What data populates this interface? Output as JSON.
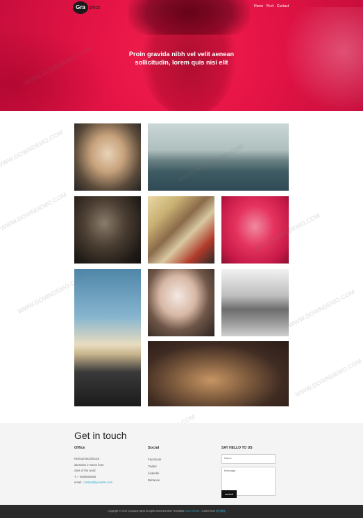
{
  "header": {
    "logo_mark": "Gra",
    "logo_rest": "phics",
    "nav": [
      "Home",
      "Work",
      "Contact"
    ],
    "hero_title_line1": "Proin gravida nibh vel velit aenean",
    "hero_title_line2": "sollicitudin, lorem quis nisi elit"
  },
  "gallery": {
    "tiles": [
      {
        "name": "woman-flower-crown-photo"
      },
      {
        "name": "misty-landscape-photo"
      },
      {
        "name": "man-in-dark-photo"
      },
      {
        "name": "colorful-cards-photo"
      },
      {
        "name": "red-portrait-photo"
      },
      {
        "name": "vintage-car-photo"
      },
      {
        "name": "woman-with-books-photo"
      },
      {
        "name": "street-with-dog-photo"
      },
      {
        "name": "cat-photo"
      }
    ]
  },
  "contact": {
    "title": "Get in touch",
    "office": {
      "title": "Office",
      "lines": [
        "Richard McClintock",
        "alteration in some form",
        "cites of the word",
        "T: + 0000000000"
      ],
      "email_label": "email :",
      "email_value": "contact@yoursite.com"
    },
    "social": {
      "title": "Social",
      "links": [
        "Facebook",
        "Twitter",
        "Linkedin",
        "Behance"
      ]
    },
    "form": {
      "title": "SAY HELLO TO US",
      "name_placeholder": "Name",
      "message_placeholder": "Message",
      "submit_label": "submit"
    }
  },
  "footer": {
    "text": "Copyright © 2014 Company name All rights reserved More Templates ",
    "link1": "more themes",
    "mid": " - Collect from ",
    "link2": "网页模板"
  },
  "watermark_text": "WWW.DOWNDEMO.COM",
  "colors": {
    "hero": "#e51446",
    "contact_bg": "#f4f4f4",
    "footer_bg": "#2b2b2b",
    "accent_link": "#2aa3c9"
  }
}
